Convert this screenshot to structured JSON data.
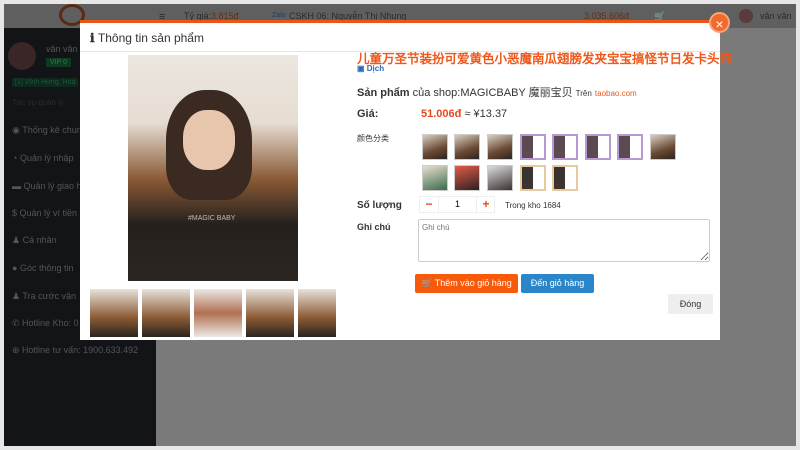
{
  "topbar": {
    "rate_label": "Tỷ giá:",
    "rate_value": "3.815đ",
    "zalo": "Zalo",
    "support": "CSKH 06: Nguyễn Thị Nhung",
    "balance": "3.035.606đ",
    "cart_count": "0",
    "notif_count": "0",
    "username": "vân vân"
  },
  "sidebar": {
    "user": "vân vân",
    "vip": "VIP 0",
    "warehouse": "[1] Vĩnh Hưng, Hoà",
    "section": "Tác vụ quản lý",
    "items": [
      {
        "icon": "dashboard-icon",
        "label": "Thống kê chung"
      },
      {
        "icon": "clock-icon",
        "label": "Quản lý nhập"
      },
      {
        "icon": "truck-icon",
        "label": "Quản lý giao h"
      },
      {
        "icon": "dollar-icon",
        "label": "Quản lý ví tiền"
      },
      {
        "icon": "user-icon",
        "label": "Cá nhân"
      },
      {
        "icon": "info-icon",
        "label": "Góc thông tin"
      },
      {
        "icon": "search-user-icon",
        "label": "Tra cước vận"
      },
      {
        "icon": "phone-icon",
        "label": "Hotline Kho: 0"
      },
      {
        "icon": "globe-icon",
        "label": "Hotline tư vấn: 1900.633.492"
      }
    ]
  },
  "modal": {
    "title": "Thông tin sản phẩm",
    "close": "×",
    "product_title": "儿童万圣节装扮可爱黄色小恶魔南瓜翅膀发夹宝宝搞怪节日发卡头饰",
    "translate": "Dịch",
    "shop_prefix": "Sản phẩm",
    "shop_text": "của shop:MAGICBABY 魔丽宝贝",
    "platform_prefix": "Trên",
    "platform": "taobao.com",
    "price_label": "Giá:",
    "price_vnd": "51.006đ",
    "price_cny": "≈ ¥13.37",
    "color_label": "颜色分类",
    "image_watermark": "#MAGIC BABY",
    "qty_label": "Số lượng",
    "qty_value": "1",
    "qty_minus": "−",
    "qty_plus": "+",
    "stock": "Trong kho 1684",
    "note_label": "Ghi chú",
    "note_placeholder": "Ghi chú",
    "add_cart": "Thêm vào giỏ hàng",
    "go_cart": "Đến giỏ hàng",
    "close_btn": "Đóng"
  },
  "colors": {
    "accent": "#f0571a",
    "button_orange": "#f85a0c",
    "button_blue": "#2a86c8"
  }
}
